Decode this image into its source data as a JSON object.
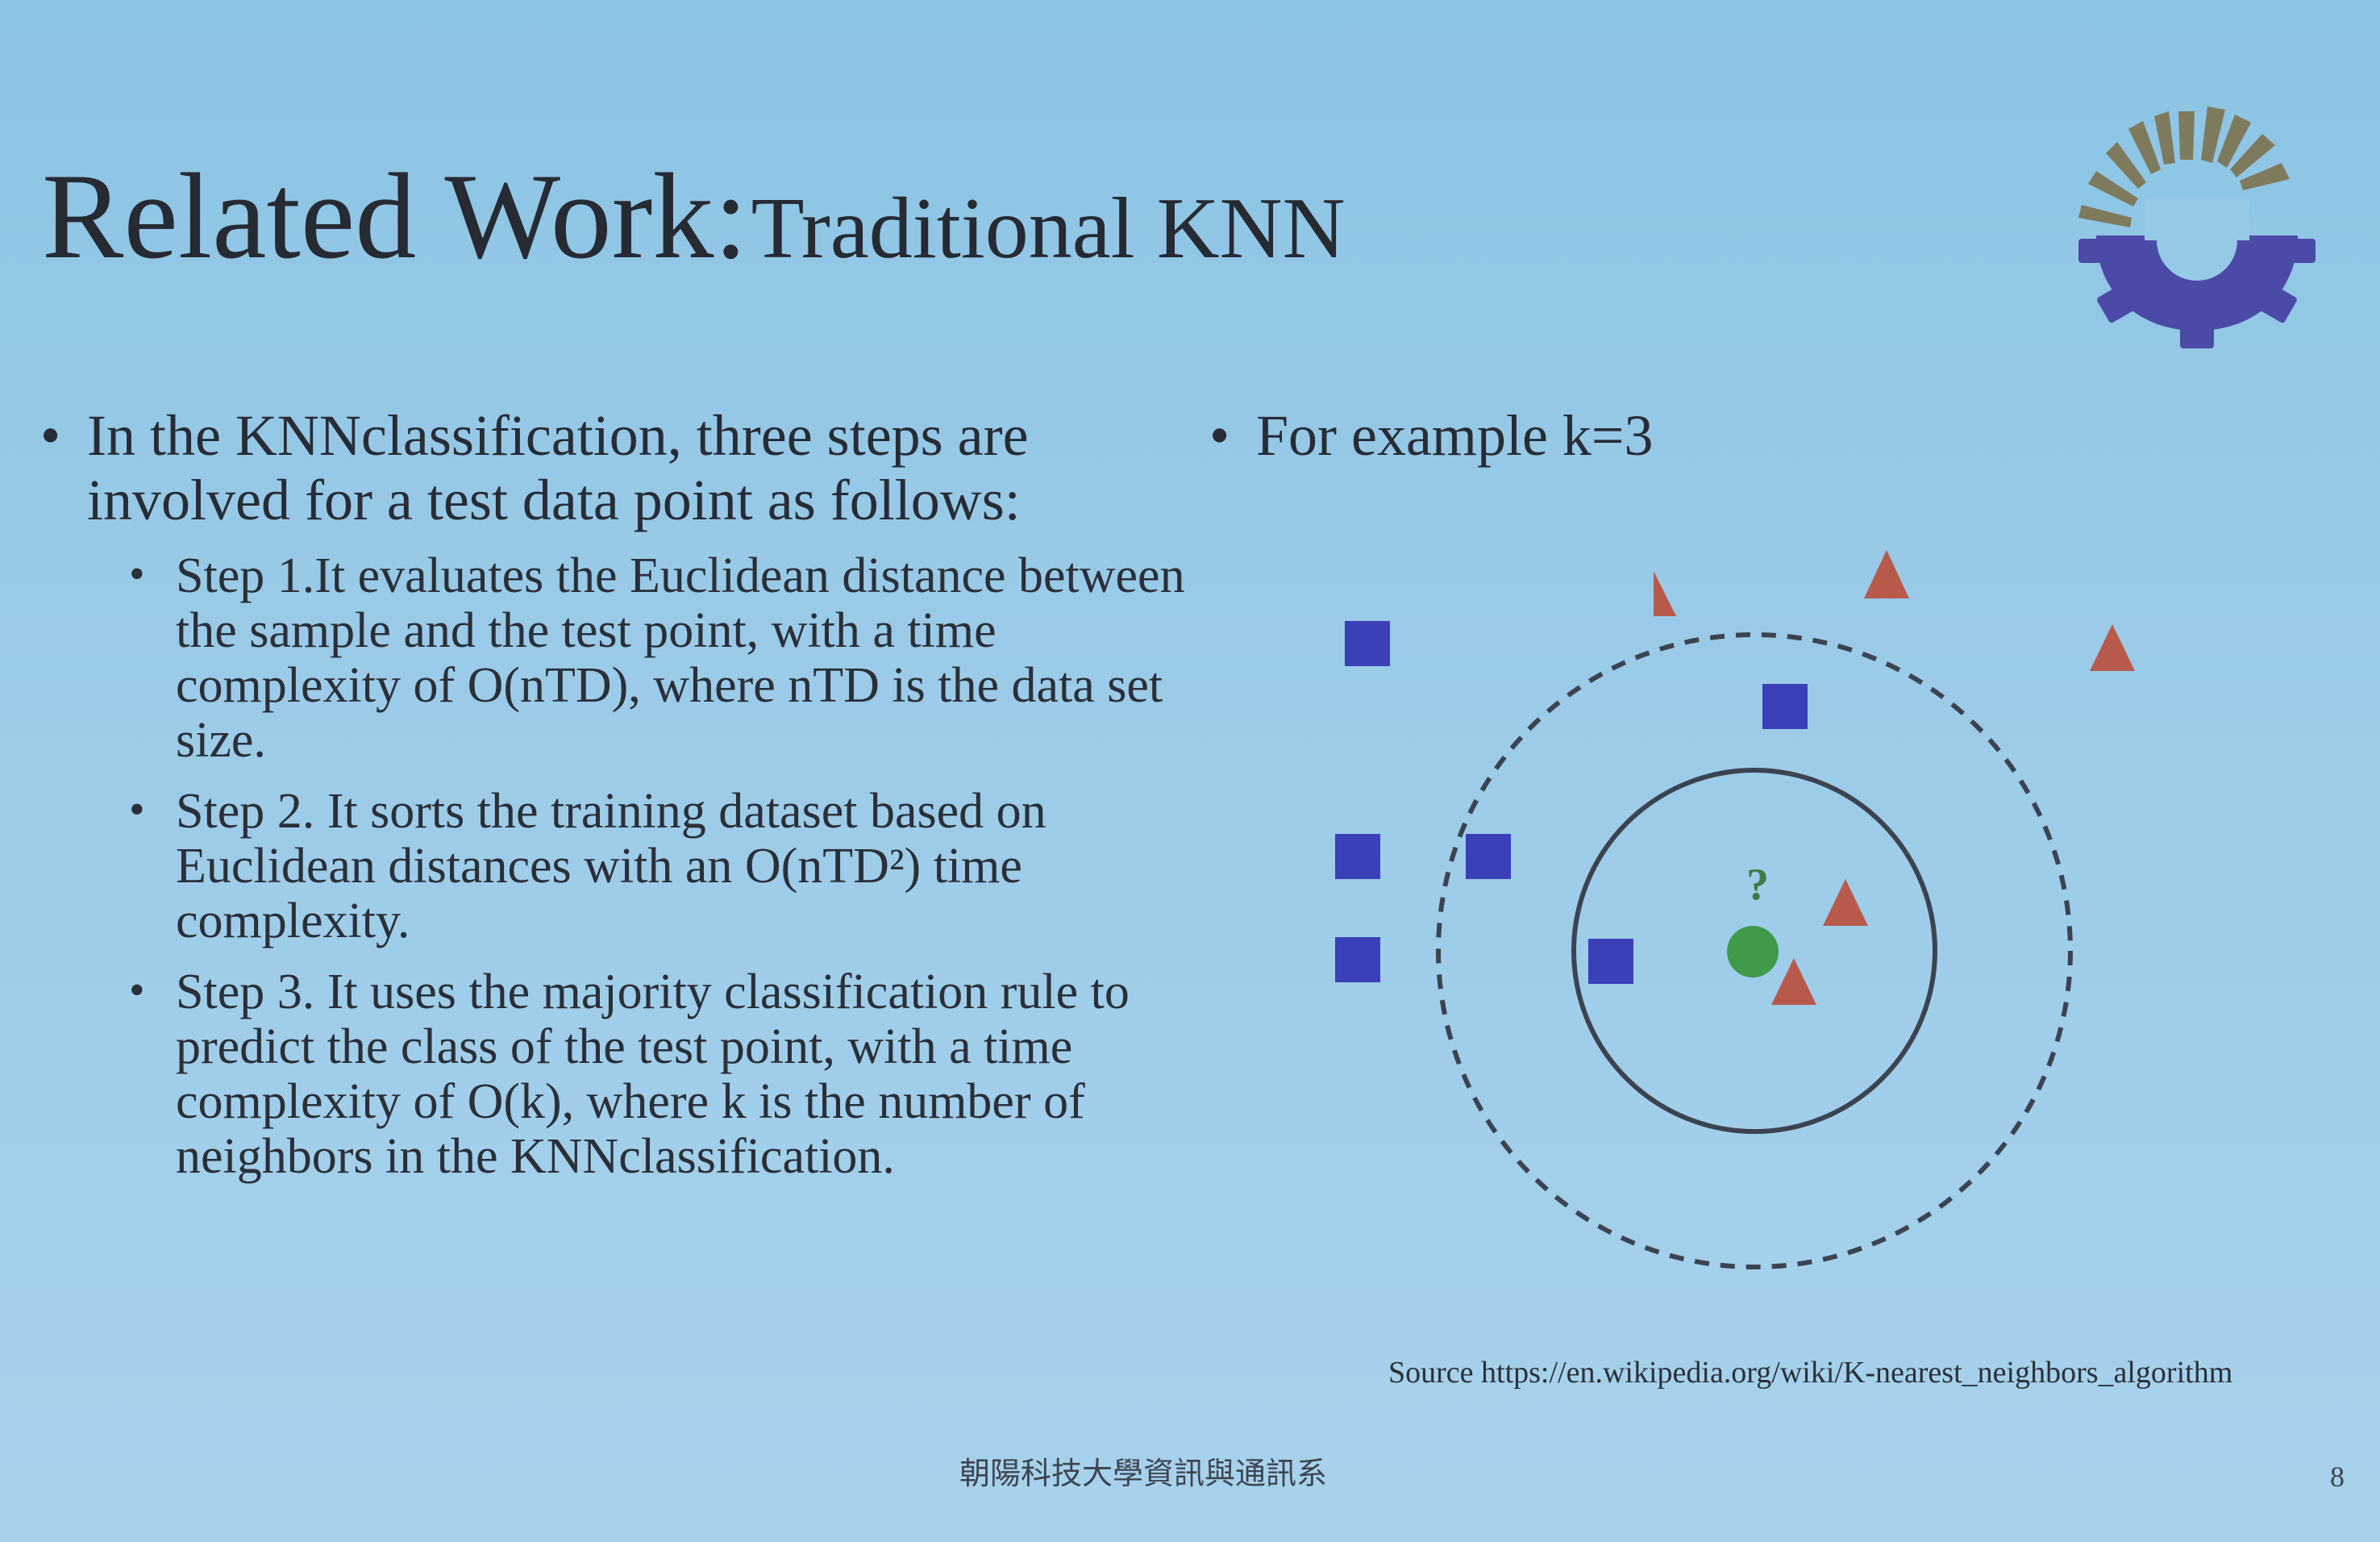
{
  "slide": {
    "title_main": "Related Work:",
    "title_sub": "Traditional KNN",
    "left": {
      "intro": "In the KNNclassification, three steps are involved for a test data point as follows:",
      "steps": [
        "Step 1.It evaluates the Euclidean distance between the sample and the test point, with a time complexity of O(nTD), where nTD is the data set size.",
        "Step 2. It sorts the training dataset based on Euclidean distances with an O(nTD²) time complexity.",
        "Step 3. It uses the majority classification rule to predict the class of the test point, with a time complexity of O(k), where k is the number of neighbors in the KNNclassification."
      ]
    },
    "right": {
      "example": "For example k=3",
      "diagram": {
        "query_label": "?",
        "colors": {
          "class_square": "#3b3fb8",
          "class_triangle": "#b75a4c",
          "query": "#3f9a4a",
          "circle": "#3c4350"
        },
        "icon_names": [
          "square-marker",
          "triangle-marker",
          "query-point"
        ]
      },
      "source": "Source https://en.wikipedia.org/wiki/K-nearest_neighbors_algorithm"
    },
    "footer": {
      "school": "朝陽科技大學資訊與通訊系",
      "page": "8"
    },
    "bullet_char": "•",
    "logo_name": "gear-sun-logo"
  }
}
